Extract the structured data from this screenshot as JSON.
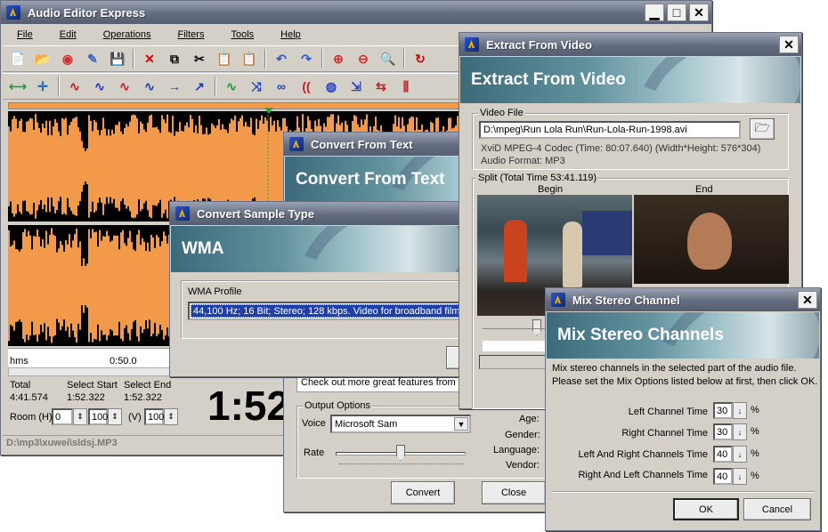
{
  "main": {
    "title": "Audio Editor Express",
    "menu": [
      "File",
      "Edit",
      "Operations",
      "Filters",
      "Tools",
      "Help"
    ],
    "time_unit": "hms",
    "time_mark": "0:50.0",
    "stats": {
      "total_label": "Total",
      "total": "4:41.574",
      "sel_start_label": "Select Start",
      "sel_start": "1:52.322",
      "sel_end_label": "Select End",
      "sel_end": "1:52.322"
    },
    "room_label": "Room (H)",
    "room_value": "0",
    "room_value2": "100",
    "v_label": "(V)",
    "v_value": "100",
    "big_time": "1:52",
    "status_path": "D:\\mp3\\xuwei\\sldsj.MP3",
    "waveform_color": "#f29a4a"
  },
  "convert_text": {
    "title": "Convert From Text",
    "banner": "Convert From Text",
    "features_text": "Check out more great features from N",
    "output_label": "Output Options",
    "voice_label": "Voice",
    "voice_value": "Microsoft Sam",
    "rate_label": "Rate",
    "rate_level": 0.5,
    "age_label": "Age:",
    "gender_label": "Gender:",
    "language_label": "Language:",
    "vendor_label": "Vendor:",
    "convert_btn": "Convert",
    "close_btn": "Close"
  },
  "sample_type": {
    "title": "Convert Sample Type",
    "banner": "WMA",
    "profile_label": "WMA Profile",
    "profile_value": "44,100 Hz; 16 Bit; Stereo; 128 kbps. Video for broadband film c"
  },
  "extract": {
    "title": "Extract From Video",
    "banner": "Extract From Video",
    "video_label": "Video File",
    "video_path": "D:\\mpeg\\Run Lola Run\\Run-Lola-Run-1998.avi",
    "codec": "XviD MPEG-4 Codec (Time: 80:07.640) (Width*Height: 576*304)",
    "audio_format": "Audio Format: MP3",
    "split_label": "Split  (Total Time 53:41.119)",
    "begin_label": "Begin",
    "end_label": "End"
  },
  "mix": {
    "title": "Mix Stereo Channel",
    "banner": "Mix Stereo Channels",
    "desc1": "Mix stereo channels in the selected part of the audio file.",
    "desc2": "Please set the Mix Options listed below at first, then click OK.",
    "rows": [
      {
        "label": "Left Channel Time",
        "value": "30",
        "unit": "%"
      },
      {
        "label": "Right Channel Time",
        "value": "30",
        "unit": "%"
      },
      {
        "label": "Left And Right Channels Time",
        "value": "40",
        "unit": "%"
      },
      {
        "label": "Right And Left Channels Time",
        "value": "40",
        "unit": "%"
      }
    ],
    "ok_btn": "OK",
    "cancel_btn": "Cancel"
  }
}
